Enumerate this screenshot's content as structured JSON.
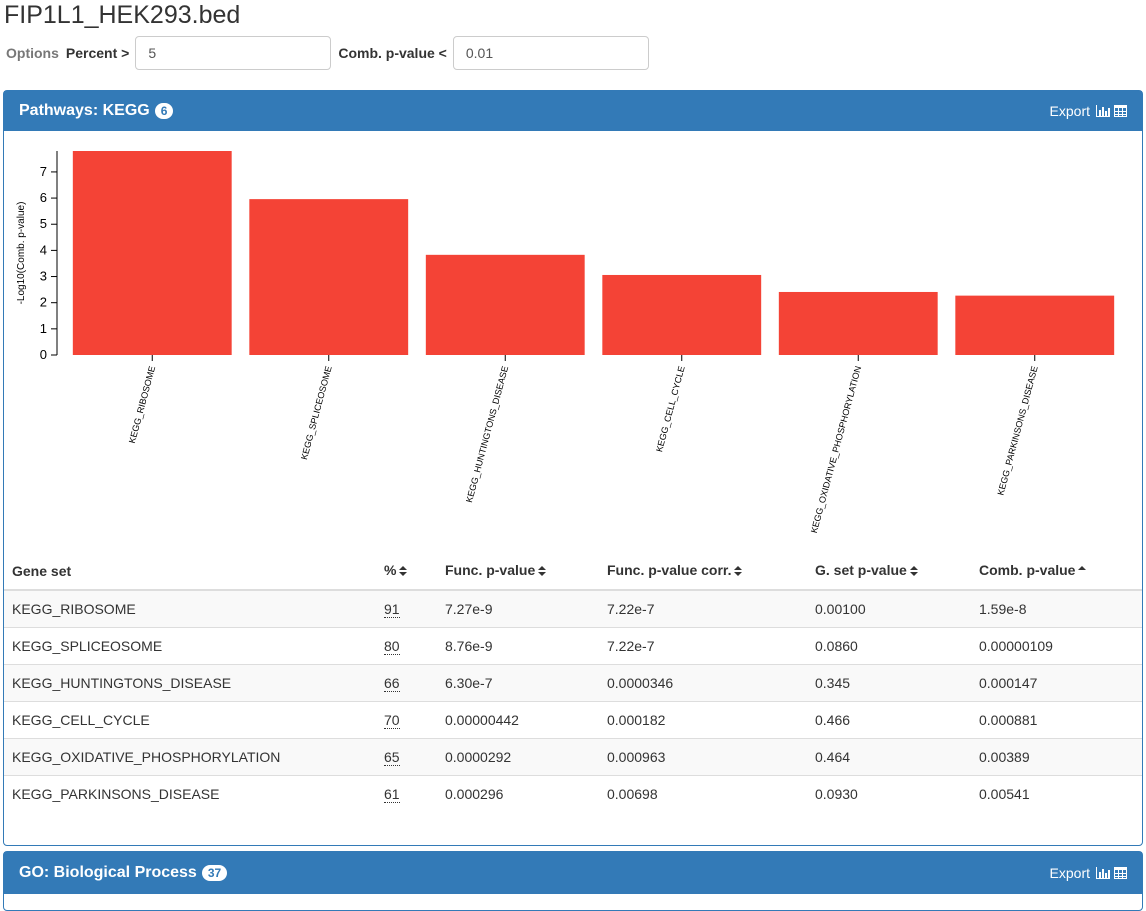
{
  "page": {
    "title": "FIP1L1_HEK293.bed"
  },
  "options": {
    "label": "Options",
    "percent_label": "Percent >",
    "percent_value": "5",
    "pvalue_label": "Comb. p-value <",
    "pvalue_value": "0.01"
  },
  "kegg_panel": {
    "title": "Pathways: KEGG",
    "count": "6",
    "export_label": "Export",
    "table": {
      "headers": [
        "Gene set",
        "%",
        "Func. p-value",
        "Func. p-value corr.",
        "G. set p-value",
        "Comb. p-value"
      ],
      "rows": [
        [
          "KEGG_RIBOSOME",
          "91",
          "7.27e-9",
          "7.22e-7",
          "0.00100",
          "1.59e-8"
        ],
        [
          "KEGG_SPLICEOSOME",
          "80",
          "8.76e-9",
          "7.22e-7",
          "0.0860",
          "0.00000109"
        ],
        [
          "KEGG_HUNTINGTONS_DISEASE",
          "66",
          "6.30e-7",
          "0.0000346",
          "0.345",
          "0.000147"
        ],
        [
          "KEGG_CELL_CYCLE",
          "70",
          "0.00000442",
          "0.000182",
          "0.466",
          "0.000881"
        ],
        [
          "KEGG_OXIDATIVE_PHOSPHORYLATION",
          "65",
          "0.0000292",
          "0.000963",
          "0.464",
          "0.00389"
        ],
        [
          "KEGG_PARKINSONS_DISEASE",
          "61",
          "0.000296",
          "0.00698",
          "0.0930",
          "0.00541"
        ]
      ],
      "sort_icons": [
        "",
        "sort-both-icon",
        "sort-both-icon",
        "sort-both-icon",
        "sort-both-icon",
        "sort-up-icon"
      ]
    }
  },
  "go_panel": {
    "title": "GO: Biological Process",
    "count": "37",
    "export_label": "Export"
  },
  "chart_data": {
    "type": "bar",
    "categories": [
      "KEGG_RIBOSOME",
      "KEGG_SPLICEOSOME",
      "KEGG_HUNTINGTONS_DISEASE",
      "KEGG_CELL_CYCLE",
      "KEGG_OXIDATIVE_PHOSPHORYLATION",
      "KEGG_PARKINSONS_DISEASE"
    ],
    "values": [
      7.8,
      5.96,
      3.83,
      3.06,
      2.41,
      2.27
    ],
    "ylabel": "-Log10(Comb. p-value)",
    "ylim": [
      0,
      7.8
    ],
    "yticks": [
      0,
      1,
      2,
      3,
      4,
      5,
      6,
      7
    ],
    "bar_color": "#f44336",
    "grid": false
  },
  "colors": {
    "primary": "#337ab7",
    "bar": "#f44336"
  }
}
